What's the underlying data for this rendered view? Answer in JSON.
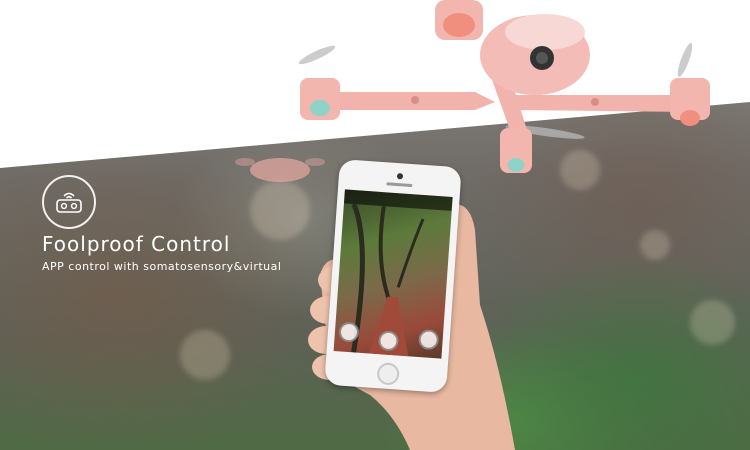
{
  "feature": {
    "icon": "remote-controller-icon",
    "title": "Foolproof Control",
    "subtitle": "APP control with somatosensory&virtual"
  },
  "colors": {
    "drone_pink": "#f2b3ad",
    "text": "#ffffff",
    "background_top": "#ffffff"
  }
}
